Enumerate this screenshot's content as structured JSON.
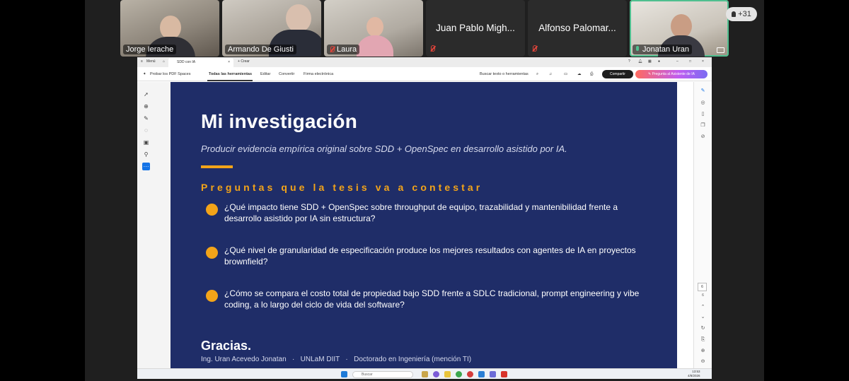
{
  "participants": [
    {
      "name": "Jorge Ierache",
      "video": true
    },
    {
      "name": "Armando De Giusti",
      "video": true
    },
    {
      "name": "Laura",
      "video": true,
      "muted": true
    },
    {
      "name": "Juan Pablo Migh...",
      "video": false,
      "muted": true
    },
    {
      "name": "Alfonso Palomar...",
      "video": false,
      "muted": true
    },
    {
      "name": "Jonatan Uran",
      "video": true,
      "speaking": true
    }
  ],
  "more_participants": "+31",
  "browser": {
    "menu_label": "Menú",
    "tab_title": "SDD con IA",
    "new_tab_label": "Crear"
  },
  "toolbar": {
    "pdf_spaces": "Probar los PDF Spaces",
    "all_tools": "Todas las herramientas",
    "edit": "Editar",
    "convert": "Convertir",
    "esign": "Firma electrónica",
    "search": "Buscar texto o herramientas",
    "share": "Compartir",
    "ai_assistant": "Pregunta al Asistente de IA"
  },
  "slide": {
    "title": "Mi investigación",
    "subtitle": "Producir evidencia empírica original sobre SDD + OpenSpec en desarrollo asistido por IA.",
    "questions_heading": "Preguntas que la tesis va a contestar",
    "questions": [
      {
        "line1": "¿Qué impacto tiene SDD + OpenSpec sobre throughput de equipo, trazabilidad y mantenibilidad frente a",
        "line2": "desarrollo asistido por IA sin estructura?"
      },
      {
        "line1": "¿Qué nivel de granularidad de especificación produce los mejores resultados con agentes de IA en proyectos",
        "line2": "brownfield?"
      },
      {
        "line1": "¿Cómo se compara el costo total de propiedad bajo SDD frente a SDLC tradicional, prompt engineering y vibe",
        "line2": "coding, a lo largo del ciclo de vida del software?"
      }
    ],
    "thanks": "Gracias.",
    "footer_name": "Ing. Uran Acevedo Jonatan",
    "footer_org": "UNLaM DIIT",
    "footer_program": "Doctorado en Ingeniería (mención TI)",
    "footer_sep": "·"
  },
  "page_indicator": {
    "current": "6",
    "total": "6"
  },
  "taskbar": {
    "search_placeholder": "Buscar",
    "time": "13:53",
    "date": "4/8/2026"
  },
  "colors": {
    "slide_bg": "#1f2d68",
    "accent": "#f3a419",
    "speaking": "#4fbf8f",
    "muted": "#e0443a"
  }
}
